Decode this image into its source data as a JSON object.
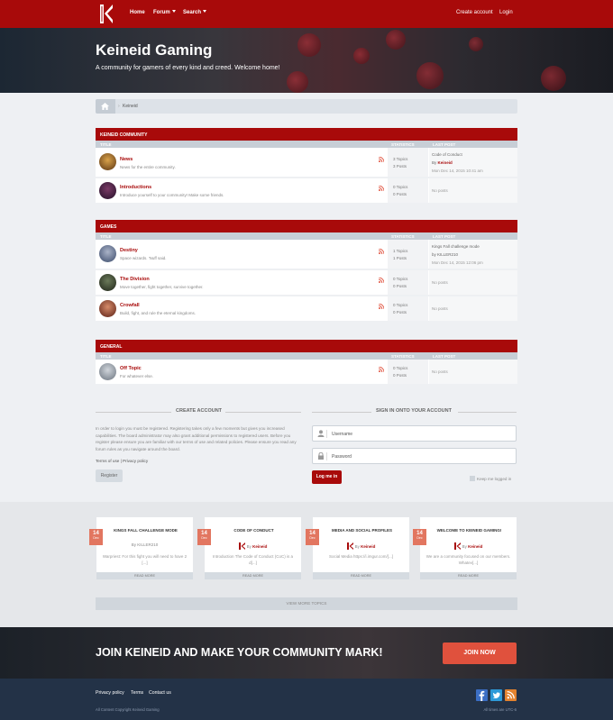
{
  "nav": {
    "logo_alt": "Keineid logo",
    "home": "Home",
    "forum": "Forum",
    "search": "Search",
    "create_account": "Create account",
    "login": "Login"
  },
  "hero": {
    "title": "Keineid Gaming",
    "subtitle": "A community for gamers of every kind and creed. Welcome home!"
  },
  "breadcrumb": {
    "current": "Keineid"
  },
  "columns": {
    "title": "TITLE",
    "statistics": "STATISTICS",
    "last_post": "LAST POST"
  },
  "categories": [
    {
      "name": "KEINEID COMMUNITY",
      "forums": [
        {
          "title": "News",
          "desc": "News for the entire community.",
          "topics": "3 Topics",
          "posts": "3 Posts",
          "last_title": "Code of Conduct",
          "last_by": "By",
          "last_author": "Keineid",
          "last_date": "Mon Dec 14, 2015 10:41 am"
        },
        {
          "title": "Introductions",
          "desc": "Introduce yourself to your community! Make some friends.",
          "topics": "0 Topics",
          "posts": "0 Posts",
          "no_posts": "No posts"
        }
      ]
    },
    {
      "name": "GAMES",
      "forums": [
        {
          "title": "Destiny",
          "desc": "Space wizards. 'Nuff said.",
          "topics": "1 Topics",
          "posts": "1 Posts",
          "last_title": "Kings Fall challenge mode",
          "last_by": "by KILLER210",
          "last_date": "Mon Dec 14, 2015 12:06 pm"
        },
        {
          "title": "The Division",
          "desc": "Move together, fight together, survive together.",
          "topics": "0 Topics",
          "posts": "0 Posts",
          "no_posts": "No posts"
        },
        {
          "title": "Crowfall",
          "desc": "Build, fight, and rule the eternal kingdoms.",
          "topics": "0 Topics",
          "posts": "0 Posts",
          "no_posts": "No posts"
        }
      ]
    },
    {
      "name": "GENERAL",
      "forums": [
        {
          "title": "Off Topic",
          "desc": "For whatever else.",
          "topics": "0 Topics",
          "posts": "0 Posts",
          "no_posts": "No posts"
        }
      ]
    }
  ],
  "account": {
    "create_title": "CREATE ACCOUNT",
    "create_text": "In order to login you must be registered. Registering takes only a few moments but gives you increased capabilities. The board administrator may also grant additional permissions to registered users. Before you register please ensure you are familiar with our terms of use and related policies. Please ensure you read any forum rules as you navigate around the board.",
    "terms": "Terms of use",
    "privacy": "Privacy policy",
    "register": "Register",
    "signin_title": "SIGN IN ONTO YOUR ACCOUNT",
    "username_placeholder": "Username",
    "password_placeholder": "Password",
    "login_btn": "Log me in",
    "remember": "Keep me logged in"
  },
  "topics": [
    {
      "day": "14",
      "month": "Dec",
      "title": "KINGS FALL CHALLENGE MODE",
      "by": "By",
      "author": "KILLER210",
      "excerpt": "Warpriest: For this fight you will need to have 2 [...]",
      "read_more": "READ MORE"
    },
    {
      "day": "14",
      "month": "Dec",
      "title": "CODE OF CONDUCT",
      "by": "By",
      "author": "Keineid",
      "excerpt": "Introduction The Code of Conduct (CoC) is a d[...]",
      "read_more": "READ MORE"
    },
    {
      "day": "14",
      "month": "Dec",
      "title": "MEDIA AND SOCIAL PROFILES",
      "by": "By",
      "author": "Keineid",
      "excerpt": "Social Media https://i.imgur.com/[...]",
      "read_more": "READ MORE"
    },
    {
      "day": "14",
      "month": "Dec",
      "title": "WELCOME TO KEINEID GAMING!",
      "by": "By",
      "author": "Keineid",
      "excerpt": "We are a community focused on our members. Whatev[...]",
      "read_more": "READ MORE"
    }
  ],
  "view_more": "VIEW MORE TOPICS",
  "cta": {
    "text": "JOIN KEINEID AND MAKE YOUR COMMUNITY MARK!",
    "button": "JOIN NOW"
  },
  "footer": {
    "privacy": "Privacy policy",
    "terms": "Terms",
    "contact": "Contact us",
    "copyright": "All Content Copyright Keineid Gaming",
    "timezone": "All times are UTC-6"
  },
  "colors": {
    "brand": "#a80a0a",
    "accent": "#e0513d",
    "footer": "#233247"
  },
  "icons": [
    "logo-icon",
    "home-icon",
    "rss-icon",
    "user-icon",
    "lock-icon",
    "facebook-icon",
    "twitter-icon",
    "rss-feed-icon"
  ]
}
